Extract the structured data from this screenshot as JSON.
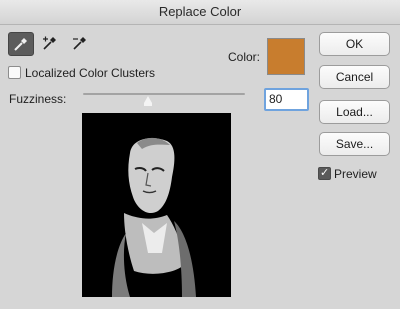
{
  "window": {
    "title": "Replace Color"
  },
  "tools": [
    {
      "name": "eyedropper-icon",
      "active": true
    },
    {
      "name": "eyedropper-plus-icon",
      "active": false
    },
    {
      "name": "eyedropper-minus-icon",
      "active": false
    }
  ],
  "localized": {
    "label": "Localized Color Clusters",
    "checked": false
  },
  "color": {
    "label": "Color:",
    "value": "#c87d2e"
  },
  "fuzziness": {
    "label": "Fuzziness:",
    "value": "80",
    "slider_fraction": 0.4
  },
  "buttons": {
    "ok": "OK",
    "cancel": "Cancel",
    "load": "Load...",
    "save": "Save..."
  },
  "preview_toggle": {
    "label": "Preview",
    "checked": true
  }
}
